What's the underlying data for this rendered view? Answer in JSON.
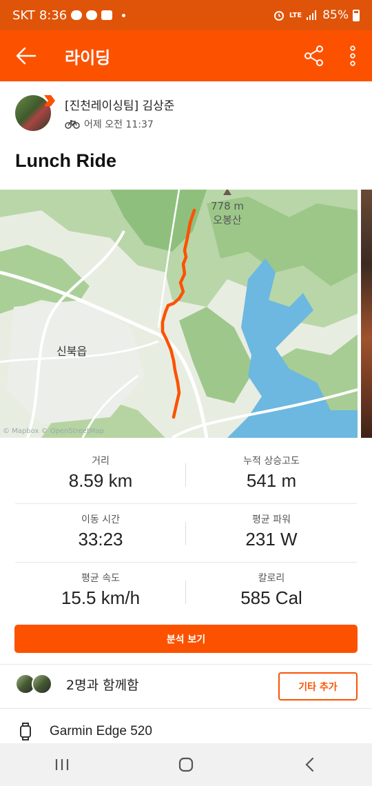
{
  "status_bar": {
    "carrier": "SKT",
    "time": "8:36",
    "network": "LTE",
    "battery": "85%"
  },
  "app_bar": {
    "title": "라이딩",
    "icons": [
      "back-arrow-icon",
      "share-icon",
      "more-vertical-icon"
    ]
  },
  "author": {
    "name": "[진천레이싱팀] 김상준",
    "timestamp": "어제 오전 11:37",
    "activity_icon": "bicycle-icon"
  },
  "activity": {
    "title": "Lunch Ride"
  },
  "map": {
    "town_label": "신북읍",
    "peak_elevation": "778 m",
    "peak_name": "오봉산",
    "attribution": "© Mapbox © OpenStreetMap",
    "route_color": "#fc5200",
    "water_color": "#6cb8e0"
  },
  "stats": [
    {
      "label": "거리",
      "value": "8.59 km"
    },
    {
      "label": "누적 상승고도",
      "value": "541 m"
    },
    {
      "label": "이동 시간",
      "value": "33:23"
    },
    {
      "label": "평균 파워",
      "value": "231 W"
    },
    {
      "label": "평균 속도",
      "value": "15.5 km/h"
    },
    {
      "label": "칼로리",
      "value": "585 Cal"
    }
  ],
  "analysis_button": "분석 보기",
  "group": {
    "text": "2명과 함께함",
    "add_button": "기타 추가"
  },
  "device": {
    "name": "Garmin Edge 520",
    "icon": "watch-icon"
  },
  "nav_bar": {
    "icons": [
      "recent-apps-icon",
      "home-icon",
      "back-icon"
    ]
  },
  "colors": {
    "brand": "#fc5200",
    "status_bar": "#e05409"
  }
}
